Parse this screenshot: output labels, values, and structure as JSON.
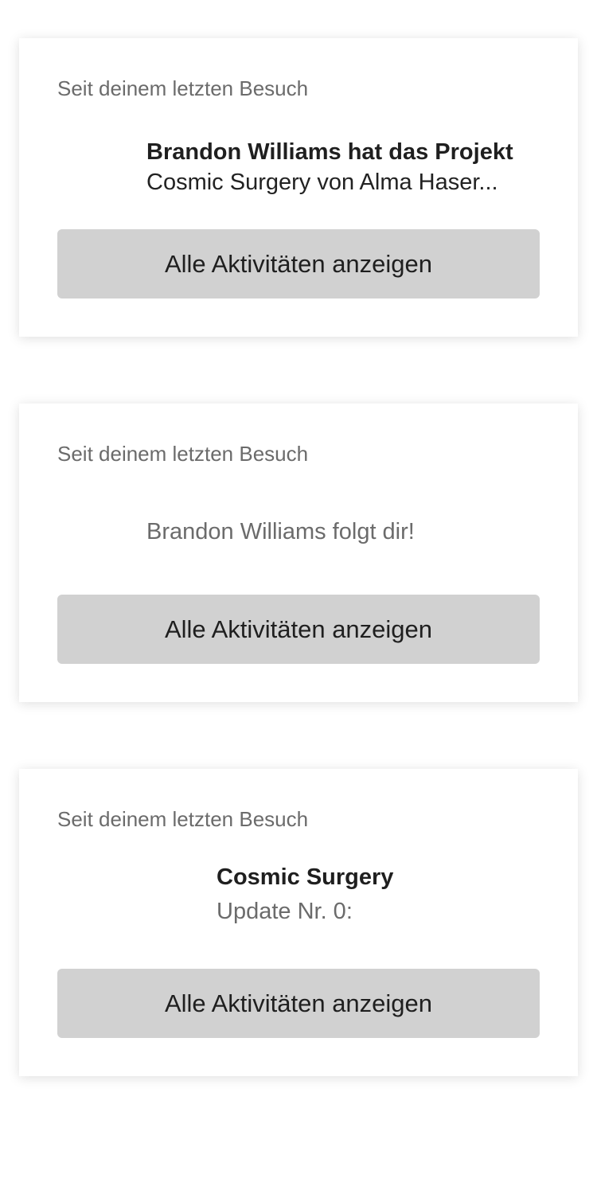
{
  "cards": [
    {
      "since_label": "Seit deinem letzten Besuch",
      "activity_bold": "Brandon Williams hat das Projekt",
      "activity_text": "Cosmic Surgery von Alma Haser...",
      "button_label": "Alle Aktivitäten anzeigen"
    },
    {
      "since_label": "Seit deinem letzten Besuch",
      "activity_text": "Brandon Williams folgt dir!",
      "button_label": "Alle Aktivitäten anzeigen"
    },
    {
      "since_label": "Seit deinem letzten Besuch",
      "activity_bold": "Cosmic Surgery",
      "activity_text": "Update Nr. 0:",
      "button_label": "Alle Aktivitäten anzeigen"
    }
  ]
}
